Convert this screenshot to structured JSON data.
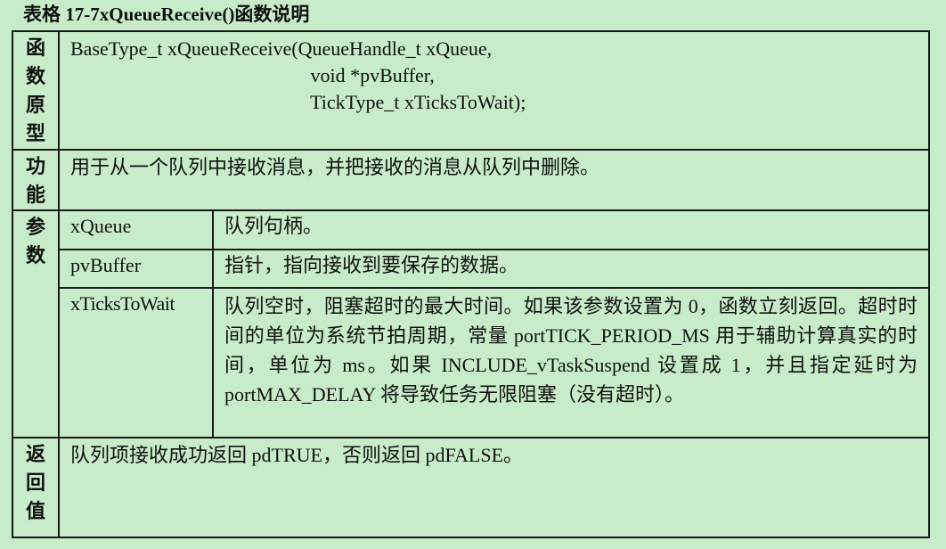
{
  "caption": "表格 17-7xQueueReceive()函数说明",
  "rows": {
    "prototype": {
      "header": "函数原型",
      "lines": [
        "BaseType_t xQueueReceive(QueueHandle_t xQueue,",
        "                                                 void *pvBuffer,",
        "                                                 TickType_t xTicksToWait);"
      ]
    },
    "function": {
      "header": "功能",
      "text": "用于从一个队列中接收消息，并把接收的消息从队列中删除。"
    },
    "params": {
      "header": "参数",
      "items": [
        {
          "name": "xQueue",
          "desc": "队列句柄。"
        },
        {
          "name": "pvBuffer",
          "desc": "指针，指向接收到要保存的数据。"
        },
        {
          "name": "xTicksToWait",
          "desc": "队列空时，阻塞超时的最大时间。如果该参数设置为 0，函数立刻返回。超时时间的单位为系统节拍周期，常量 portTICK_PERIOD_MS 用于辅助计算真实的时间，单位为 ms。如果 INCLUDE_vTaskSuspend 设置成 1，并且指定延时为 portMAX_DELAY 将导致任务无限阻塞（没有超时）。"
        }
      ]
    },
    "returns": {
      "header": "返回值",
      "text": "队列项接收成功返回 pdTRUE，否则返回 pdFALSE。"
    }
  }
}
